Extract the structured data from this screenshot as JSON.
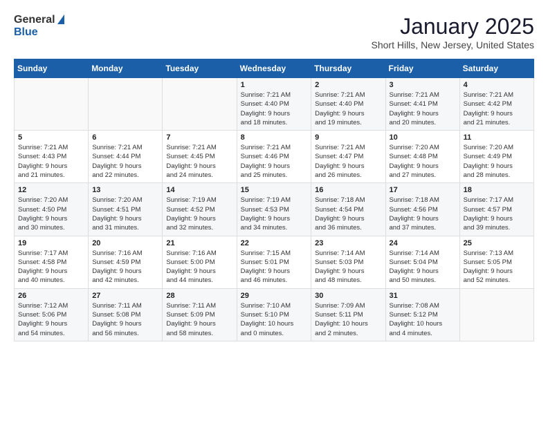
{
  "header": {
    "logo_general": "General",
    "logo_blue": "Blue",
    "title": "January 2025",
    "subtitle": "Short Hills, New Jersey, United States"
  },
  "weekdays": [
    "Sunday",
    "Monday",
    "Tuesday",
    "Wednesday",
    "Thursday",
    "Friday",
    "Saturday"
  ],
  "weeks": [
    [
      {
        "day": "",
        "info": ""
      },
      {
        "day": "",
        "info": ""
      },
      {
        "day": "",
        "info": ""
      },
      {
        "day": "1",
        "info": "Sunrise: 7:21 AM\nSunset: 4:40 PM\nDaylight: 9 hours\nand 18 minutes."
      },
      {
        "day": "2",
        "info": "Sunrise: 7:21 AM\nSunset: 4:40 PM\nDaylight: 9 hours\nand 19 minutes."
      },
      {
        "day": "3",
        "info": "Sunrise: 7:21 AM\nSunset: 4:41 PM\nDaylight: 9 hours\nand 20 minutes."
      },
      {
        "day": "4",
        "info": "Sunrise: 7:21 AM\nSunset: 4:42 PM\nDaylight: 9 hours\nand 21 minutes."
      }
    ],
    [
      {
        "day": "5",
        "info": "Sunrise: 7:21 AM\nSunset: 4:43 PM\nDaylight: 9 hours\nand 21 minutes."
      },
      {
        "day": "6",
        "info": "Sunrise: 7:21 AM\nSunset: 4:44 PM\nDaylight: 9 hours\nand 22 minutes."
      },
      {
        "day": "7",
        "info": "Sunrise: 7:21 AM\nSunset: 4:45 PM\nDaylight: 9 hours\nand 24 minutes."
      },
      {
        "day": "8",
        "info": "Sunrise: 7:21 AM\nSunset: 4:46 PM\nDaylight: 9 hours\nand 25 minutes."
      },
      {
        "day": "9",
        "info": "Sunrise: 7:21 AM\nSunset: 4:47 PM\nDaylight: 9 hours\nand 26 minutes."
      },
      {
        "day": "10",
        "info": "Sunrise: 7:20 AM\nSunset: 4:48 PM\nDaylight: 9 hours\nand 27 minutes."
      },
      {
        "day": "11",
        "info": "Sunrise: 7:20 AM\nSunset: 4:49 PM\nDaylight: 9 hours\nand 28 minutes."
      }
    ],
    [
      {
        "day": "12",
        "info": "Sunrise: 7:20 AM\nSunset: 4:50 PM\nDaylight: 9 hours\nand 30 minutes."
      },
      {
        "day": "13",
        "info": "Sunrise: 7:20 AM\nSunset: 4:51 PM\nDaylight: 9 hours\nand 31 minutes."
      },
      {
        "day": "14",
        "info": "Sunrise: 7:19 AM\nSunset: 4:52 PM\nDaylight: 9 hours\nand 32 minutes."
      },
      {
        "day": "15",
        "info": "Sunrise: 7:19 AM\nSunset: 4:53 PM\nDaylight: 9 hours\nand 34 minutes."
      },
      {
        "day": "16",
        "info": "Sunrise: 7:18 AM\nSunset: 4:54 PM\nDaylight: 9 hours\nand 36 minutes."
      },
      {
        "day": "17",
        "info": "Sunrise: 7:18 AM\nSunset: 4:56 PM\nDaylight: 9 hours\nand 37 minutes."
      },
      {
        "day": "18",
        "info": "Sunrise: 7:17 AM\nSunset: 4:57 PM\nDaylight: 9 hours\nand 39 minutes."
      }
    ],
    [
      {
        "day": "19",
        "info": "Sunrise: 7:17 AM\nSunset: 4:58 PM\nDaylight: 9 hours\nand 40 minutes."
      },
      {
        "day": "20",
        "info": "Sunrise: 7:16 AM\nSunset: 4:59 PM\nDaylight: 9 hours\nand 42 minutes."
      },
      {
        "day": "21",
        "info": "Sunrise: 7:16 AM\nSunset: 5:00 PM\nDaylight: 9 hours\nand 44 minutes."
      },
      {
        "day": "22",
        "info": "Sunrise: 7:15 AM\nSunset: 5:01 PM\nDaylight: 9 hours\nand 46 minutes."
      },
      {
        "day": "23",
        "info": "Sunrise: 7:14 AM\nSunset: 5:03 PM\nDaylight: 9 hours\nand 48 minutes."
      },
      {
        "day": "24",
        "info": "Sunrise: 7:14 AM\nSunset: 5:04 PM\nDaylight: 9 hours\nand 50 minutes."
      },
      {
        "day": "25",
        "info": "Sunrise: 7:13 AM\nSunset: 5:05 PM\nDaylight: 9 hours\nand 52 minutes."
      }
    ],
    [
      {
        "day": "26",
        "info": "Sunrise: 7:12 AM\nSunset: 5:06 PM\nDaylight: 9 hours\nand 54 minutes."
      },
      {
        "day": "27",
        "info": "Sunrise: 7:11 AM\nSunset: 5:08 PM\nDaylight: 9 hours\nand 56 minutes."
      },
      {
        "day": "28",
        "info": "Sunrise: 7:11 AM\nSunset: 5:09 PM\nDaylight: 9 hours\nand 58 minutes."
      },
      {
        "day": "29",
        "info": "Sunrise: 7:10 AM\nSunset: 5:10 PM\nDaylight: 10 hours\nand 0 minutes."
      },
      {
        "day": "30",
        "info": "Sunrise: 7:09 AM\nSunset: 5:11 PM\nDaylight: 10 hours\nand 2 minutes."
      },
      {
        "day": "31",
        "info": "Sunrise: 7:08 AM\nSunset: 5:12 PM\nDaylight: 10 hours\nand 4 minutes."
      },
      {
        "day": "",
        "info": ""
      }
    ]
  ]
}
